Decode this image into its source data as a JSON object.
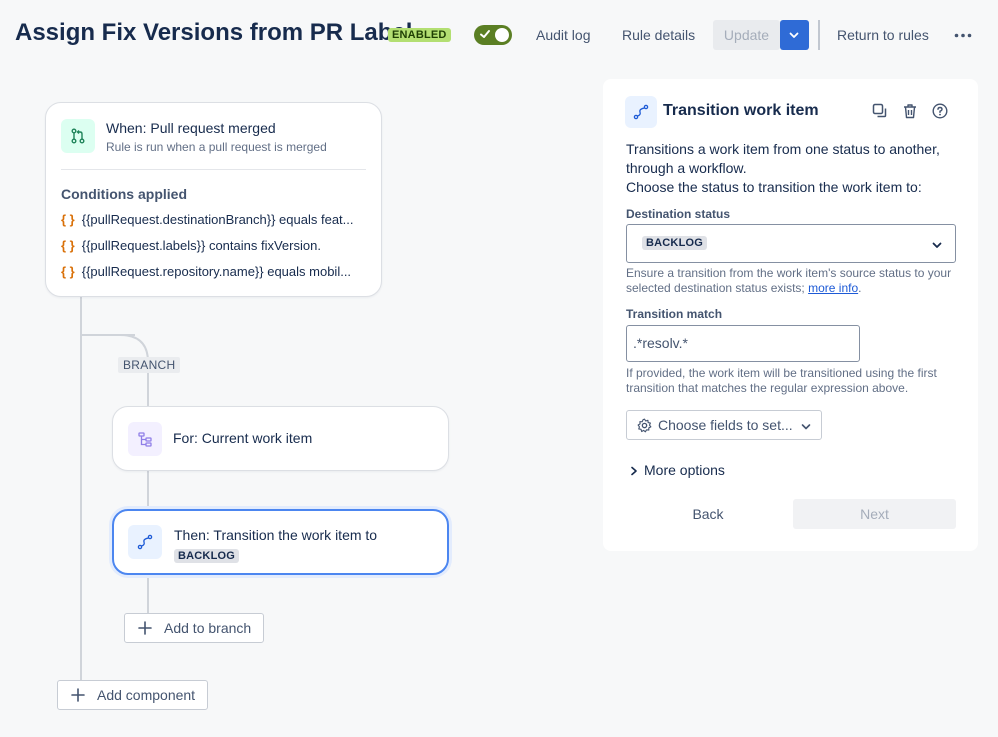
{
  "header": {
    "title": "Assign Fix Versions from PR Label",
    "status_badge": "ENABLED",
    "toggle_on": true,
    "audit_log": "Audit log",
    "rule_details": "Rule details",
    "update": "Update",
    "return": "Return to rules"
  },
  "trigger": {
    "title": "When: Pull request merged",
    "subtitle": "Rule is run when a pull request is merged",
    "conditions_heading": "Conditions applied",
    "conditions": [
      "{{pullRequest.destinationBranch}} equals feat...",
      "{{pullRequest.labels}} contains fixVersion.",
      "{{pullRequest.repository.name}} equals mobil..."
    ],
    "brace": "{ }"
  },
  "branch": {
    "tag": "BRANCH",
    "for_label": "For: Current work item",
    "then_label": "Then: Transition the work item to",
    "then_status": "BACKLOG",
    "add_to_branch": "Add to branch"
  },
  "add_component": "Add component",
  "panel": {
    "title": "Transition work item",
    "description_1": "Transitions a work item from one status to another, through a workflow.",
    "description_2": "Choose the status to transition the work item to:",
    "destination_label": "Destination status",
    "destination_value": "BACKLOG",
    "destination_help": "Ensure a transition from the work item's source status to your selected destination status exists;",
    "more_info": "more info",
    "help_period": ".",
    "match_label": "Transition match",
    "match_value": ".*resolv.*",
    "match_help": "If provided, the work item will be transitioned using the first transition that matches the regular expression above.",
    "choose_fields": "Choose fields to set...",
    "more_options": "More options",
    "back": "Back",
    "next": "Next"
  },
  "colors": {
    "accent": "#2f6bd6",
    "toggle": "#5b7f24",
    "badge": "#b3df72",
    "condition_brace": "#d97008"
  },
  "icons": {
    "trigger": "pull-request-icon",
    "branch": "branch-tree-icon",
    "action": "transition-icon",
    "copy": "copy-icon",
    "delete": "trash-icon",
    "help": "help-icon",
    "settings": "gear-icon"
  }
}
